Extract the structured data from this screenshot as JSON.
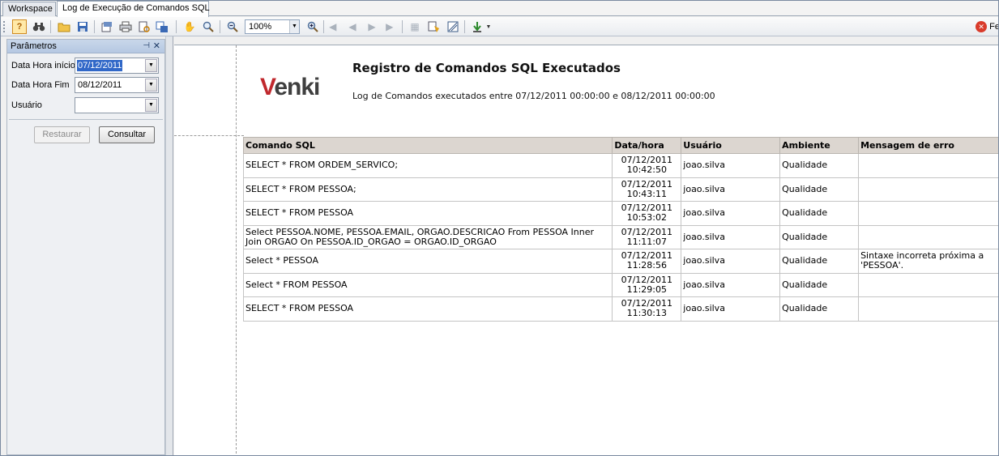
{
  "tabs": [
    {
      "label": "Workspace"
    },
    {
      "label": "Log de Execução de Comandos SQL"
    }
  ],
  "toolbar": {
    "zoom": "100%",
    "close_label": "Fe"
  },
  "params": {
    "title": "Parâmetros",
    "start_label": "Data Hora início",
    "start_value": "07/12/2011",
    "end_label": "Data Hora Fim",
    "end_value": "08/12/2011",
    "user_label": "Usuário",
    "user_value": "",
    "restore_label": "Restaurar",
    "query_label": "Consultar"
  },
  "report": {
    "logo_v": "V",
    "logo_rest": "enki",
    "title": "Registro de Comandos SQL Executados",
    "subtitle": "Log de Comandos executados entre 07/12/2011 00:00:00 e 08/12/2011 00:00:00",
    "columns": [
      "Comando SQL",
      "Data/hora",
      "Usuário",
      "Ambiente",
      "Mensagem de erro"
    ],
    "rows": [
      {
        "cmd": "SELECT * FROM ORDEM_SERVICO;",
        "date": "07/12/2011",
        "time": "10:42:50",
        "user": "joao.silva",
        "env": "Qualidade",
        "err": ""
      },
      {
        "cmd": "SELECT * FROM PESSOA;",
        "date": "07/12/2011",
        "time": "10:43:11",
        "user": "joao.silva",
        "env": "Qualidade",
        "err": ""
      },
      {
        "cmd": "SELECT * FROM PESSOA",
        "date": "07/12/2011",
        "time": "10:53:02",
        "user": "joao.silva",
        "env": "Qualidade",
        "err": ""
      },
      {
        "cmd": "Select PESSOA.NOME, PESSOA.EMAIL, ORGAO.DESCRICAO From PESSOA Inner Join ORGAO On PESSOA.ID_ORGAO = ORGAO.ID_ORGAO",
        "date": "07/12/2011",
        "time": "11:11:07",
        "user": "joao.silva",
        "env": "Qualidade",
        "err": ""
      },
      {
        "cmd": "Select * PESSOA",
        "date": "07/12/2011",
        "time": "11:28:56",
        "user": "joao.silva",
        "env": "Qualidade",
        "err": "Sintaxe incorreta próxima a 'PESSOA'."
      },
      {
        "cmd": "Select * FROM PESSOA",
        "date": "07/12/2011",
        "time": "11:29:05",
        "user": "joao.silva",
        "env": "Qualidade",
        "err": ""
      },
      {
        "cmd": "SELECT * FROM PESSOA",
        "date": "07/12/2011",
        "time": "11:30:13",
        "user": "joao.silva",
        "env": "Qualidade",
        "err": ""
      }
    ]
  }
}
